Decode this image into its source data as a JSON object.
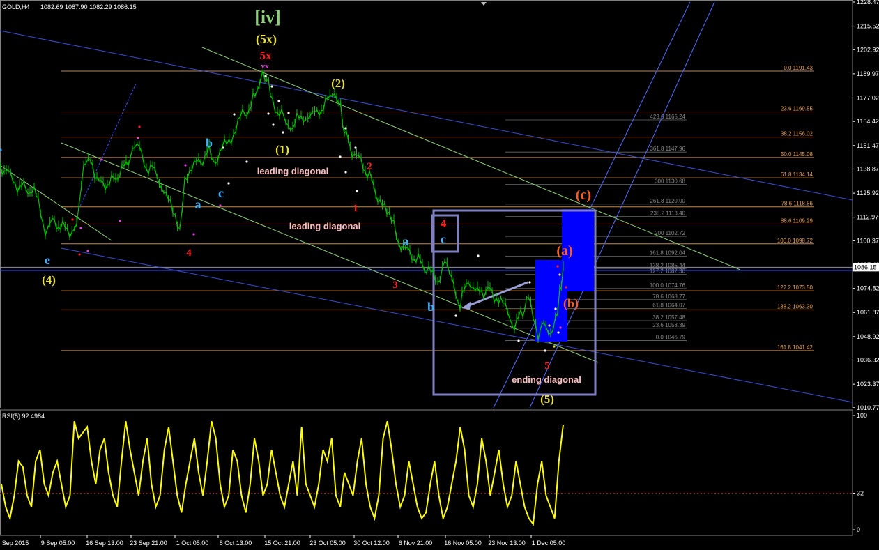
{
  "header": {
    "symbol": "GOLD,H4",
    "ohlc": "1082.69 1087.90 1082.29 1086.15"
  },
  "rsi_header": "RSI(5) 92.4984",
  "current_price_label": "1086.15",
  "colors": {
    "background": "#000000",
    "candles": "#00c000",
    "rsi_line": "#ffff00",
    "fib_line": "#e8a050",
    "trend_blue": "#3a4fd0",
    "trend_green": "#8fd07a",
    "box": "#8080c0",
    "zone_blue": "#0000ff"
  },
  "chart_data": [
    {
      "type": "line",
      "title": "GOLD,H4",
      "ylim": [
        1010.7,
        1228.47
      ],
      "y_ticks": [
        "1228.47",
        "1215.52",
        "1202.92",
        "1189.97",
        "1177.02",
        "1164.42",
        "1151.47",
        "1138.87",
        "1125.92",
        "1112.97",
        "1100.37",
        "1087.42",
        "1074.82",
        "1061.87",
        "1048.92",
        "1036.32",
        "1023.37",
        "1010.77"
      ],
      "x_ticks": [
        "Sep 2015",
        "9 Sep 05:00",
        "16 Sep 13:00",
        "23 Sep 21:00",
        "1 Oct 05:00",
        "8 Oct 13:00",
        "15 Oct 21:00",
        "23 Oct 05:00",
        "30 Oct 12:00",
        "6 Nov 21:00",
        "16 Nov 05:00",
        "23 Nov 13:00",
        "1 Dec 05:00"
      ],
      "series": [
        {
          "x": [
            0,
            12,
            25,
            40,
            55,
            65,
            75,
            90,
            100,
            110,
            120,
            130,
            145,
            160,
            175,
            190,
            200,
            210,
            222,
            235,
            248,
            258,
            265,
            272,
            285,
            300,
            312,
            322,
            335,
            348,
            360,
            372,
            380,
            388,
            398,
            410,
            420,
            432,
            445,
            458,
            470,
            480,
            486,
            494,
            505,
            518,
            530,
            542,
            555,
            565,
            572,
            585,
            600,
            615,
            628,
            638,
            648,
            660,
            672,
            685,
            700,
            712,
            725,
            738,
            750,
            758,
            765,
            772,
            780,
            790,
            800,
            808
          ],
          "values": [
            1141,
            1136,
            1130,
            1128,
            1124,
            1105,
            1110,
            1108,
            1102,
            1112,
            1140,
            1142,
            1130,
            1132,
            1138,
            1148,
            1150,
            1140,
            1138,
            1128,
            1115,
            1108,
            1135,
            1138,
            1142,
            1148,
            1142,
            1152,
            1158,
            1168,
            1172,
            1186,
            1190,
            1180,
            1170,
            1165,
            1162,
            1168,
            1166,
            1170,
            1175,
            1181,
            1175,
            1160,
            1148,
            1142,
            1135,
            1124,
            1114,
            1112,
            1100,
            1094,
            1090,
            1084,
            1078,
            1092,
            1078,
            1066,
            1080,
            1072,
            1074,
            1070,
            1064,
            1055,
            1062,
            1070,
            1060,
            1050,
            1056,
            1052,
            1062,
            1086
          ]
        }
      ],
      "fib_levels": [
        {
          "label": "0.0  1191.43",
          "value": 1191.43
        },
        {
          "label": "23.6  1169.55",
          "value": 1169.55
        },
        {
          "label": "38.2  1156.02",
          "value": 1156.02
        },
        {
          "label": "50.0  1145.08",
          "value": 1145.08
        },
        {
          "label": "61.8  1134.14",
          "value": 1134.14
        },
        {
          "label": "78.6  1118.56",
          "value": 1118.56
        },
        {
          "label": "88.6  1109.29",
          "value": 1109.29
        },
        {
          "label": "100.0  1098.72",
          "value": 1098.72
        },
        {
          "label": "127.2  1073.50",
          "value": 1073.5
        },
        {
          "label": "138.2  1063.30",
          "value": 1063.3
        },
        {
          "label": "161.8  1041.42",
          "value": 1041.42
        }
      ],
      "fib_levels_secondary": [
        {
          "label": "423.6  1165.24",
          "value": 1165.24
        },
        {
          "label": "361.8  1147.96",
          "value": 1147.96
        },
        {
          "label": "300  1130.68",
          "value": 1130.68
        },
        {
          "label": "261.8  1120.00",
          "value": 1120.0
        },
        {
          "label": "238.2  1113.40",
          "value": 1113.4
        },
        {
          "label": "200  1102.72",
          "value": 1102.72
        },
        {
          "label": "161.8  1092.04",
          "value": 1092.04
        },
        {
          "label": "138.2  1085.44",
          "value": 1085.44
        },
        {
          "label": "127.2  1082.36",
          "value": 1082.36
        },
        {
          "label": "100.0  1074.76",
          "value": 1074.76
        },
        {
          "label": "78.6  1068.77",
          "value": 1068.77
        },
        {
          "label": "61.8  1064.07",
          "value": 1064.07
        },
        {
          "label": "38.2  1057.48",
          "value": 1057.48
        },
        {
          "label": "23.6  1053.39",
          "value": 1053.39
        },
        {
          "label": "0.0  1046.79",
          "value": 1046.79
        }
      ],
      "annotations": [
        {
          "text": "[iv]",
          "color": "#8fd07a",
          "size": 26
        },
        {
          "text": "(5x)",
          "color": "#e8e040",
          "size": 18
        },
        {
          "text": "5x",
          "color": "#ff2020",
          "size": 17
        },
        {
          "text": "vx",
          "color": "#e040e0",
          "size": 11
        },
        {
          "text": "(2)",
          "color": "#e8e040",
          "size": 17
        },
        {
          "text": "(1)",
          "color": "#e8e040",
          "size": 17
        },
        {
          "text": "leading diagonal",
          "color": "#ffc0c0",
          "size": 13
        },
        {
          "text": "leading diagonal",
          "color": "#ffc0c0",
          "size": 13
        },
        {
          "text": "ending diagonal",
          "color": "#ffc0c0",
          "size": 13
        },
        {
          "text": "(c)",
          "color": "#ff6020",
          "size": 20
        },
        {
          "text": "(a)",
          "color": "#ff6020",
          "size": 20
        },
        {
          "text": "(b)",
          "color": "#ff6020",
          "size": 18
        },
        {
          "text": "(5)",
          "color": "#e8e040",
          "size": 17
        },
        {
          "text": "(4)",
          "color": "#e8e040",
          "size": 17
        },
        {
          "text": "e",
          "color": "#40b0ff",
          "size": 18
        },
        {
          "text": "a",
          "color": "#40b0ff",
          "size": 18
        },
        {
          "text": "b",
          "color": "#40b0ff",
          "size": 18
        },
        {
          "text": "c",
          "color": "#40b0ff",
          "size": 18
        },
        {
          "text": "4",
          "color": "#ff2020",
          "size": 17
        },
        {
          "text": "c",
          "color": "#40b0ff",
          "size": 18
        },
        {
          "text": "a",
          "color": "#40b0ff",
          "size": 18
        },
        {
          "text": "b",
          "color": "#40b0ff",
          "size": 18
        },
        {
          "text": "1",
          "color": "#ff2020",
          "size": 15
        },
        {
          "text": "2",
          "color": "#ff2020",
          "size": 15
        },
        {
          "text": "3",
          "color": "#ff2020",
          "size": 15
        },
        {
          "text": "4",
          "color": "#ff2020",
          "size": 15
        },
        {
          "text": "5",
          "color": "#ff2020",
          "size": 15
        }
      ]
    },
    {
      "type": "line",
      "title": "RSI(5) 92.4984",
      "ylim": [
        0,
        100
      ],
      "y_ticks": [
        "100",
        "32",
        "0"
      ],
      "reference_line": 32,
      "series": [
        {
          "values": [
            40,
            20,
            10,
            30,
            60,
            55,
            30,
            20,
            60,
            70,
            40,
            30,
            50,
            60,
            40,
            20,
            30,
            95,
            80,
            85,
            90,
            60,
            40,
            70,
            80,
            50,
            30,
            20,
            60,
            95,
            70,
            50,
            30,
            60,
            80,
            40,
            20,
            30,
            70,
            90,
            60,
            30,
            15,
            40,
            60,
            80,
            50,
            30,
            60,
            95,
            80,
            40,
            20,
            30,
            70,
            60,
            30,
            15,
            40,
            80,
            60,
            30,
            40,
            70,
            50,
            30,
            20,
            40,
            60,
            30,
            90,
            40,
            30,
            20,
            40,
            70,
            60,
            80,
            30,
            20,
            50,
            40,
            30,
            60,
            80,
            40,
            20,
            10,
            30,
            80,
            95,
            70,
            40,
            20,
            30,
            60,
            40,
            20,
            10,
            15,
            40,
            60,
            30,
            10,
            20,
            40,
            60,
            90,
            70,
            30,
            20,
            40,
            80,
            60,
            30,
            50,
            70,
            40,
            20,
            30,
            60,
            40,
            20,
            10,
            5,
            40,
            60,
            30,
            20,
            10,
            60,
            92
          ]
        }
      ]
    }
  ]
}
